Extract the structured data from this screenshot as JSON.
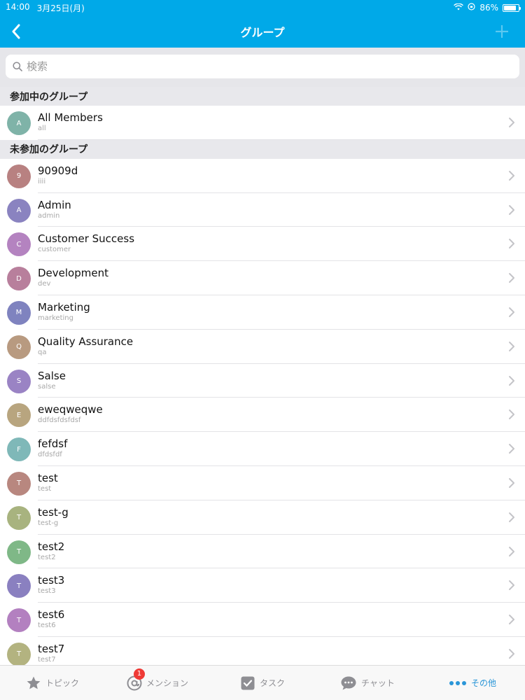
{
  "status": {
    "time": "14:00",
    "date": "3月25日(月)",
    "battery": "86%",
    "battery_level": 0.86
  },
  "nav": {
    "title": "グループ",
    "back_icon": "chevron-left-icon",
    "add_icon": "plus-icon"
  },
  "search": {
    "placeholder": "検索",
    "value": ""
  },
  "sections": [
    {
      "title": "参加中のグループ",
      "items": [
        {
          "initial": "A",
          "name": "All Members",
          "sub": "all",
          "color": "#7fb3a8"
        }
      ]
    },
    {
      "title": "未参加のグループ",
      "items": [
        {
          "initial": "9",
          "name": "90909d",
          "sub": "iiii",
          "color": "#b88181"
        },
        {
          "initial": "A",
          "name": "Admin",
          "sub": "admin",
          "color": "#8a83c0"
        },
        {
          "initial": "C",
          "name": "Customer Success",
          "sub": "customer",
          "color": "#b483c0"
        },
        {
          "initial": "D",
          "name": "Development",
          "sub": "dev",
          "color": "#b87f9c"
        },
        {
          "initial": "M",
          "name": "Marketing",
          "sub": "marketing",
          "color": "#7f83bf"
        },
        {
          "initial": "Q",
          "name": "Quality Assurance",
          "sub": "qa",
          "color": "#b89a80"
        },
        {
          "initial": "S",
          "name": "Salse",
          "sub": "salse",
          "color": "#9a83c4"
        },
        {
          "initial": "E",
          "name": "eweqweqwe",
          "sub": "ddfdsfdsfdsf",
          "color": "#b8a57f"
        },
        {
          "initial": "F",
          "name": "fefdsf",
          "sub": "dfdsfdf",
          "color": "#7fb8b8"
        },
        {
          "initial": "T",
          "name": "test",
          "sub": "test",
          "color": "#b8877f"
        },
        {
          "initial": "T",
          "name": "test-g",
          "sub": "test-g",
          "color": "#a8b37f"
        },
        {
          "initial": "T",
          "name": "test2",
          "sub": "test2",
          "color": "#7fb887"
        },
        {
          "initial": "T",
          "name": "test3",
          "sub": "test3",
          "color": "#8a80c0"
        },
        {
          "initial": "T",
          "name": "test6",
          "sub": "test6",
          "color": "#b380c0"
        },
        {
          "initial": "T",
          "name": "test7",
          "sub": "test7",
          "color": "#b3b380"
        }
      ]
    }
  ],
  "tabbar": [
    {
      "id": "topic",
      "label": "トピック",
      "icon": "star-icon",
      "active": false
    },
    {
      "id": "mention",
      "label": "メンション",
      "icon": "at-icon",
      "active": false,
      "badge": "1"
    },
    {
      "id": "task",
      "label": "タスク",
      "icon": "checkbox-icon",
      "active": false
    },
    {
      "id": "chat",
      "label": "チャット",
      "icon": "chat-bubble-icon",
      "active": false
    },
    {
      "id": "more",
      "label": "その他",
      "icon": "more-dots-icon",
      "active": true
    }
  ],
  "colors": {
    "header": "#00a9e8",
    "active_tab": "#2a96d8",
    "badge": "#ef3a36"
  }
}
